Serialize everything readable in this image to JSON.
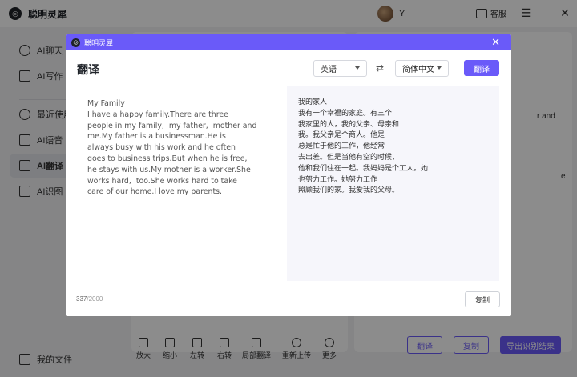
{
  "app": {
    "brand": "聪明灵犀",
    "user_name": "Y",
    "service_label": "客服"
  },
  "sidebar": {
    "items": [
      {
        "label": "AI聊天",
        "icon": "chat-icon"
      },
      {
        "label": "AI写作",
        "icon": "write-icon"
      },
      {
        "label": "最近使用",
        "icon": "clock-icon"
      },
      {
        "label": "AI语音",
        "icon": "voice-icon"
      },
      {
        "label": "AI翻译",
        "icon": "translate-icon"
      },
      {
        "label": "AI识图",
        "icon": "image-icon"
      }
    ],
    "active_index": 4,
    "my_files": "我的文件"
  },
  "background": {
    "partial_texts": [
      "r and",
      "e"
    ],
    "toolbar": [
      "放大",
      "缩小",
      "左转",
      "右转",
      "局部翻译",
      "重新上传",
      "更多"
    ],
    "translate_button": "翻译",
    "copy_button": "复制",
    "export_button": "导出识别结果"
  },
  "modal": {
    "header_title": "聪明灵犀",
    "title": "翻译",
    "source_language": "英语",
    "target_language": "简体中文",
    "swap_symbol": "⇄",
    "translate_button": "翻译",
    "source_text": "My Family\nI have a happy family.There are three\npeople in my family,  my father,  mother and\nme.My father is a businessman.He is\nalways busy with his work and he often\ngoes to business trips.But when he is free,\nhe stays with us.My mother is a worker.She\nworks hard,  too.She works hard to take\ncare of our home.I love my parents.",
    "translated_text": "我的家人\n我有一个幸福的家庭。有三个\n我家里的人，我的父亲、母亲和\n我。我父亲是个商人。他是\n总是忙于他的工作，他经常\n去出差。但是当他有空的时候，\n他和我们住在一起。我妈妈是个工人。她\n也努力工作。她努力工作\n照顾我们的家。我爱我的父母。",
    "char_count": "337",
    "char_limit": "/2000",
    "copy_button": "复制"
  },
  "colors": {
    "accent": "#6a5af9",
    "overlay": "rgba(0,0,0,0.45)"
  }
}
